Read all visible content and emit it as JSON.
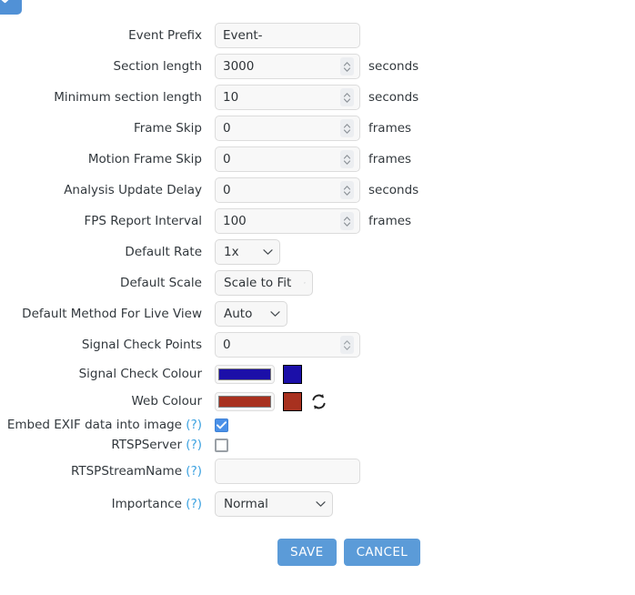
{
  "top_button": {
    "icon": "check-icon",
    "color": "#5191d6"
  },
  "form": {
    "rows": [
      {
        "label": "Event Prefix",
        "type": "text",
        "value": "Event-",
        "unit": ""
      },
      {
        "label": "Section length",
        "type": "number",
        "value": "3000",
        "unit": "seconds"
      },
      {
        "label": "Minimum section length",
        "type": "number",
        "value": "10",
        "unit": "seconds"
      },
      {
        "label": "Frame Skip",
        "type": "number",
        "value": "0",
        "unit": "frames"
      },
      {
        "label": "Motion Frame Skip",
        "type": "number",
        "value": "0",
        "unit": "frames"
      },
      {
        "label": "Analysis Update Delay",
        "type": "number",
        "value": "0",
        "unit": "seconds"
      },
      {
        "label": "FPS Report Interval",
        "type": "number",
        "value": "100",
        "unit": "frames"
      },
      {
        "label": "Default Rate",
        "type": "select",
        "value": "1x"
      },
      {
        "label": "Default Scale",
        "type": "select",
        "value": "Scale to Fit"
      },
      {
        "label": "Default Method For Live View",
        "type": "select",
        "value": "Auto"
      },
      {
        "label": "Signal Check Points",
        "type": "number",
        "value": "0",
        "unit": ""
      },
      {
        "label": "Signal Check Colour",
        "type": "color",
        "value": "#1b0fa8"
      },
      {
        "label": "Web Colour",
        "type": "color",
        "value": "#a8311f",
        "sync_icon": "sync-icon"
      },
      {
        "label": "Embed EXIF data into image",
        "type": "checkbox",
        "value": "checked",
        "help": "(?)"
      },
      {
        "label": "RTSPServer",
        "type": "checkbox",
        "value": "unchecked",
        "help": "(?)"
      },
      {
        "label": "RTSPStreamName",
        "type": "text",
        "value": "",
        "help": "(?)"
      },
      {
        "label": "Importance",
        "type": "select",
        "value": "Normal",
        "help": "(?)"
      }
    ],
    "labels": {
      "event_prefix": "Event Prefix",
      "section_length": "Section length",
      "minimum_section_length": "Minimum section length",
      "frame_skip": "Frame Skip",
      "motion_frame_skip": "Motion Frame Skip",
      "analysis_update_delay": "Analysis Update Delay",
      "fps_report_interval": "FPS Report Interval",
      "default_rate": "Default Rate",
      "default_scale": "Default Scale",
      "default_method_live_view": "Default Method For Live View",
      "signal_check_points": "Signal Check Points",
      "signal_check_colour": "Signal Check Colour",
      "web_colour": "Web Colour",
      "embed_exif": "Embed EXIF data into image",
      "rtsp_server": "RTSPServer",
      "rtsp_stream_name": "RTSPStreamName",
      "importance": "Importance"
    },
    "values": {
      "event_prefix": "Event-",
      "section_length": "3000",
      "minimum_section_length": "10",
      "frame_skip": "0",
      "motion_frame_skip": "0",
      "analysis_update_delay": "0",
      "fps_report_interval": "100",
      "default_rate": "1x",
      "default_scale": "Scale to Fit",
      "default_method_live_view": "Auto",
      "signal_check_points": "0",
      "rtsp_stream_name": "",
      "importance": "Normal"
    },
    "units": {
      "seconds": "seconds",
      "frames": "frames"
    },
    "help_marker": "(?)",
    "colors": {
      "signal_check_colour": "#1b0fa8",
      "web_colour": "#a8311f",
      "checkbox_checked": "#4a90e8",
      "button": "#5b9bd8",
      "help_link": "#3ba1e0"
    }
  },
  "actions": {
    "save_label": "SAVE",
    "cancel_label": "CANCEL"
  }
}
